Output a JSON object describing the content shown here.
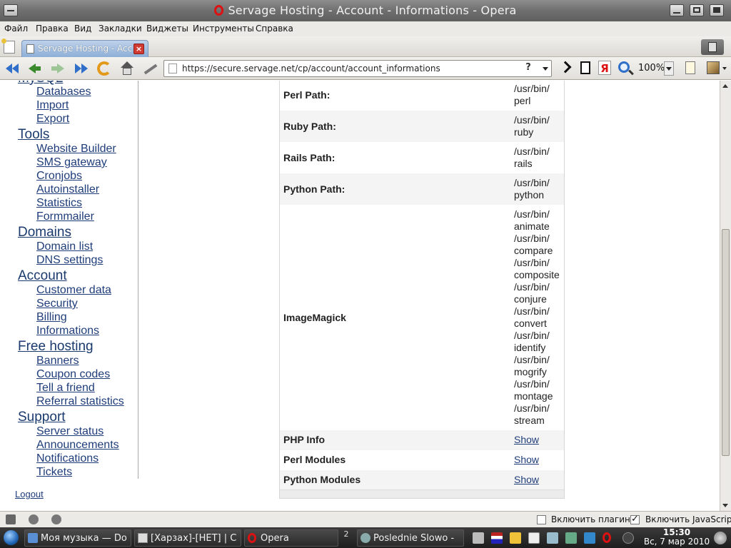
{
  "window": {
    "title": "Servage Hosting - Account - Informations - Opera"
  },
  "menu": [
    "Файл",
    "Правка",
    "Вид",
    "Закладки",
    "Виджеты",
    "Инструменты",
    "Справка"
  ],
  "tab": {
    "label": "Servage Hosting - Acc..."
  },
  "address_bar": {
    "url": "https://secure.servage.net/cp/account/account_informations",
    "help_glyph": "?"
  },
  "toolbar": {
    "zoom": "100%",
    "yandex_glyph": "Я"
  },
  "sidebar": {
    "partial_top": "MySQL",
    "sections": [
      {
        "title": null,
        "items": [
          "Databases",
          "Import",
          "Export"
        ]
      },
      {
        "title": "Tools",
        "items": [
          "Website Builder",
          "SMS gateway",
          "Cronjobs",
          "Autoinstaller",
          "Statistics",
          "Formmailer"
        ]
      },
      {
        "title": "Domains",
        "items": [
          "Domain list",
          "DNS settings"
        ]
      },
      {
        "title": "Account",
        "items": [
          "Customer data",
          "Security",
          "Billing",
          "Informations"
        ]
      },
      {
        "title": "Free hosting",
        "items": [
          "Banners",
          "Coupon codes",
          "Tell a friend",
          "Referral statistics"
        ]
      },
      {
        "title": "Support",
        "items": [
          "Server status",
          "Announcements",
          "Notifications",
          "Tickets"
        ]
      }
    ],
    "logout": "Logout"
  },
  "info_table": {
    "rows": [
      {
        "key": "Perl Path:",
        "lines": [
          "/usr/bin/",
          "perl"
        ]
      },
      {
        "key": "Ruby Path:",
        "lines": [
          "/usr/bin/",
          "ruby"
        ]
      },
      {
        "key": "Rails Path:",
        "lines": [
          "/usr/bin/",
          "rails"
        ]
      },
      {
        "key": "Python Path:",
        "lines": [
          "/usr/bin/",
          "python"
        ]
      },
      {
        "key": "ImageMagick",
        "lines": [
          "/usr/bin/",
          "animate",
          "/usr/bin/",
          "compare",
          "/usr/bin/",
          "composite",
          "/usr/bin/",
          "conjure",
          "/usr/bin/",
          "convert",
          "/usr/bin/",
          "identify",
          "/usr/bin/",
          "mogrify",
          "/usr/bin/",
          "montage",
          "/usr/bin/",
          "stream"
        ]
      },
      {
        "key": "PHP Info",
        "link": "Show"
      },
      {
        "key": "Perl Modules",
        "link": "Show"
      },
      {
        "key": "Python Modules",
        "link": "Show"
      }
    ]
  },
  "statusbar": {
    "plugins_label": "Включить плагины",
    "plugins_checked": false,
    "javascript_label": "Включить JavaScript",
    "javascript_checked": true
  },
  "taskbar": {
    "tasks": [
      "Моя музыка — Do",
      "[Харзах]-[НЕТ] | C",
      "Opera",
      "Poslednie Slowo -"
    ],
    "pager": "2",
    "clock_time": "15:30",
    "clock_date": "Вс, 7 мар 2010"
  },
  "colors": {
    "link": "#1f3d7a",
    "tab_active": "#8eafd8",
    "opera_red": "#d11111"
  }
}
